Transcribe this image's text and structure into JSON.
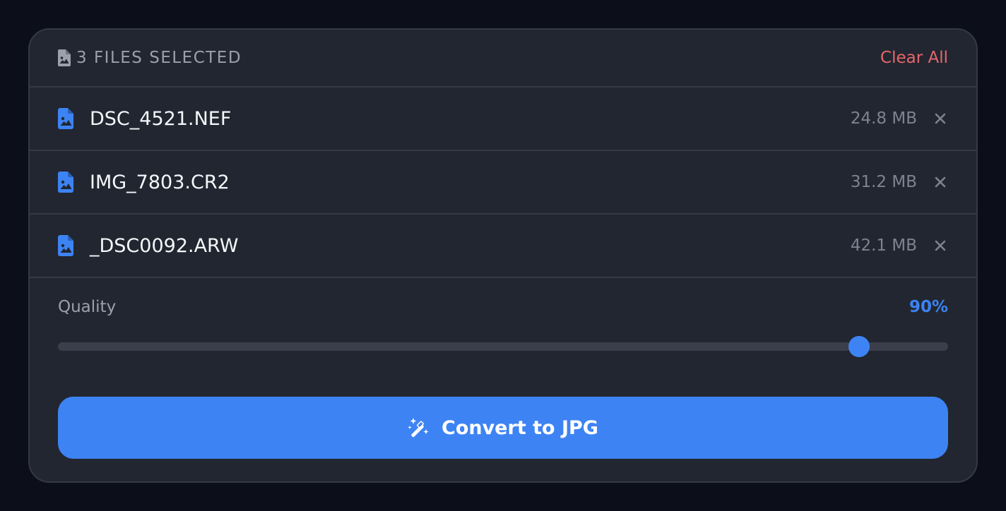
{
  "header": {
    "title": "3 FILES SELECTED",
    "icon": "file-image-icon",
    "clear_label": "Clear All"
  },
  "files": [
    {
      "name": "DSC_4521.NEF",
      "size": "24.8 MB",
      "icon": "file-image-icon"
    },
    {
      "name": "IMG_7803.CR2",
      "size": "31.2 MB",
      "icon": "file-image-icon"
    },
    {
      "name": "_DSC0092.ARW",
      "size": "42.1 MB",
      "icon": "file-image-icon"
    }
  ],
  "quality": {
    "label": "Quality",
    "value_text": "90%",
    "value": 0.9
  },
  "convert": {
    "label": "Convert to JPG",
    "icon": "magic-wand-icon"
  },
  "colors": {
    "accent": "#3d83f3",
    "danger": "#e5676b",
    "card": "#222630",
    "background": "#0c0f1a"
  }
}
